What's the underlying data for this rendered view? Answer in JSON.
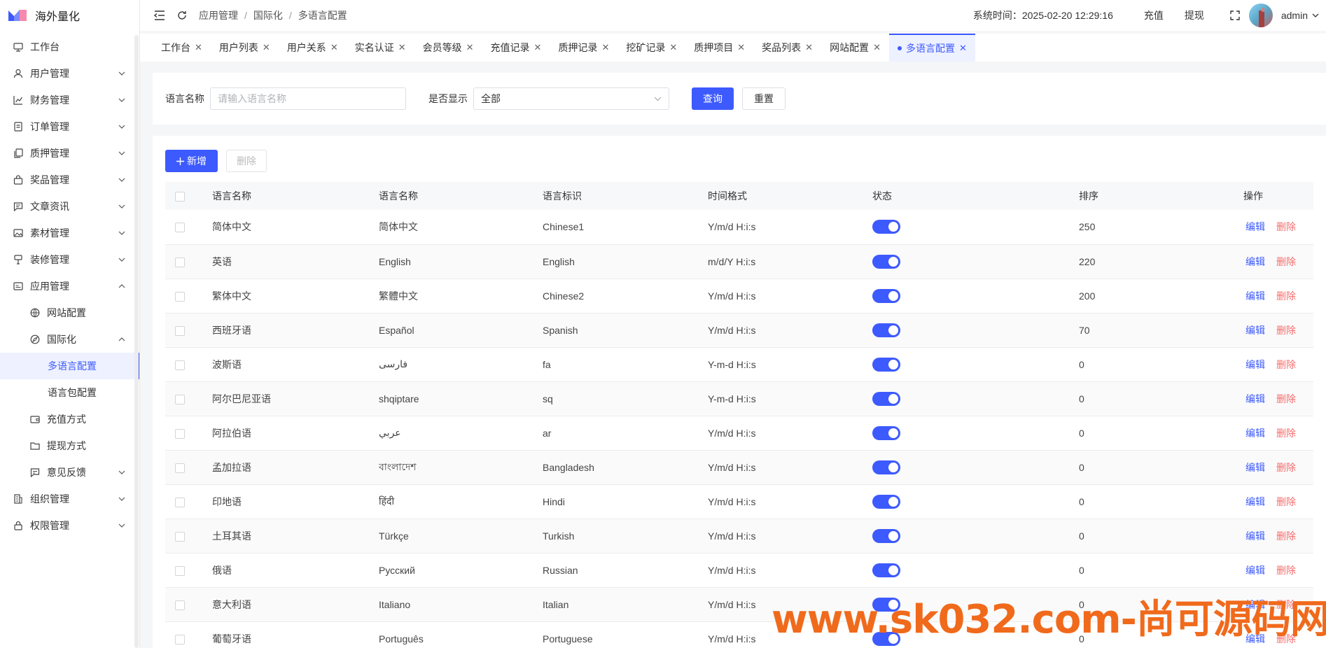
{
  "app": {
    "title": "海外量化"
  },
  "sidebar": {
    "items": [
      {
        "label": "工作台",
        "icon": "monitor-icon",
        "chevron": false
      },
      {
        "label": "用户管理",
        "icon": "user-icon",
        "chevron": true
      },
      {
        "label": "财务管理",
        "icon": "chart-icon",
        "chevron": true
      },
      {
        "label": "订单管理",
        "icon": "document-icon",
        "chevron": true
      },
      {
        "label": "质押管理",
        "icon": "copy-icon",
        "chevron": true
      },
      {
        "label": "奖品管理",
        "icon": "bag-icon",
        "chevron": true
      },
      {
        "label": "文章资讯",
        "icon": "message-icon",
        "chevron": true
      },
      {
        "label": "素材管理",
        "icon": "picture-icon",
        "chevron": true
      },
      {
        "label": "装修管理",
        "icon": "brush-icon",
        "chevron": true
      },
      {
        "label": "应用管理",
        "icon": "app-icon",
        "chevron": true,
        "expanded": true
      },
      {
        "label": "网站配置",
        "icon": "globe-icon",
        "level": 1
      },
      {
        "label": "国际化",
        "icon": "compass-icon",
        "level": 1,
        "chevron": true,
        "expanded": true
      },
      {
        "label": "多语言配置",
        "level": 2,
        "active": true
      },
      {
        "label": "语言包配置",
        "level": 2
      },
      {
        "label": "充值方式",
        "icon": "wallet-icon",
        "level": 1
      },
      {
        "label": "提现方式",
        "icon": "folder-icon",
        "level": 1
      },
      {
        "label": "意见反馈",
        "icon": "feedback-icon",
        "level": 1,
        "chevron": true
      },
      {
        "label": "组织管理",
        "icon": "building-icon",
        "chevron": true
      },
      {
        "label": "权限管理",
        "icon": "lock-icon",
        "chevron": true
      }
    ]
  },
  "header": {
    "breadcrumb": [
      "应用管理",
      "国际化",
      "多语言配置"
    ],
    "system_time_label": "系统时间：",
    "system_time": "2025-02-20 12:29:16",
    "recharge": "充值",
    "withdraw": "提现",
    "user": "admin"
  },
  "tabs": [
    {
      "label": "工作台"
    },
    {
      "label": "用户列表"
    },
    {
      "label": "用户关系"
    },
    {
      "label": "实名认证"
    },
    {
      "label": "会员等级"
    },
    {
      "label": "充值记录"
    },
    {
      "label": "质押记录"
    },
    {
      "label": "挖矿记录"
    },
    {
      "label": "质押项目"
    },
    {
      "label": "奖品列表"
    },
    {
      "label": "网站配置"
    },
    {
      "label": "多语言配置",
      "active": true
    }
  ],
  "search": {
    "name_label": "语言名称",
    "name_placeholder": "请输入语言名称",
    "show_label": "是否显示",
    "show_value": "全部",
    "query": "查询",
    "reset": "重置"
  },
  "toolbar": {
    "add": "新增",
    "delete": "删除"
  },
  "table": {
    "columns": [
      "语言名称",
      "语言名称",
      "语言标识",
      "时间格式",
      "状态",
      "排序",
      "操作"
    ],
    "edit_label": "编辑",
    "delete_label": "删除",
    "rows": [
      {
        "name": "简体中文",
        "native": "简体中文",
        "code": "Chinese1",
        "format": "Y/m/d H:i:s",
        "status": true,
        "sort": "250"
      },
      {
        "name": "英语",
        "native": "English",
        "code": "English",
        "format": "m/d/Y H:i:s",
        "status": true,
        "sort": "220"
      },
      {
        "name": "繁体中文",
        "native": "繁體中文",
        "code": "Chinese2",
        "format": "Y/m/d H:i:s",
        "status": true,
        "sort": "200"
      },
      {
        "name": "西班牙语",
        "native": "Español",
        "code": "Spanish",
        "format": "Y/m/d H:i:s",
        "status": true,
        "sort": "70"
      },
      {
        "name": "波斯语",
        "native": "فارسی",
        "code": "fa",
        "format": "Y-m-d H:i:s",
        "status": true,
        "sort": "0"
      },
      {
        "name": "阿尔巴尼亚语",
        "native": "shqiptare",
        "code": "sq",
        "format": "Y-m-d H:i:s",
        "status": true,
        "sort": "0"
      },
      {
        "name": "阿拉伯语",
        "native": "عربي",
        "code": "ar",
        "format": "Y/m/d H:i:s",
        "status": true,
        "sort": "0"
      },
      {
        "name": "孟加拉语",
        "native": "বাংলাদেশ",
        "code": "Bangladesh",
        "format": "Y/m/d H:i:s",
        "status": true,
        "sort": "0"
      },
      {
        "name": "印地语",
        "native": "हिंदी",
        "code": "Hindi",
        "format": "Y/m/d H:i:s",
        "status": true,
        "sort": "0"
      },
      {
        "name": "土耳其语",
        "native": "Türkçe",
        "code": "Turkish",
        "format": "Y/m/d H:i:s",
        "status": true,
        "sort": "0"
      },
      {
        "name": "俄语",
        "native": "Русский",
        "code": "Russian",
        "format": "Y/m/d H:i:s",
        "status": true,
        "sort": "0"
      },
      {
        "name": "意大利语",
        "native": "Italiano",
        "code": "Italian",
        "format": "Y/m/d H:i:s",
        "status": true,
        "sort": "0"
      },
      {
        "name": "葡萄牙语",
        "native": "Português",
        "code": "Portuguese",
        "format": "Y/m/d H:i:s",
        "status": true,
        "sort": "0"
      }
    ]
  },
  "watermark": "www.sk032.com-尚可源码网",
  "colors": {
    "primary": "#3d5afe",
    "danger": "#f56c6c",
    "watermark": "#f06a1c"
  }
}
